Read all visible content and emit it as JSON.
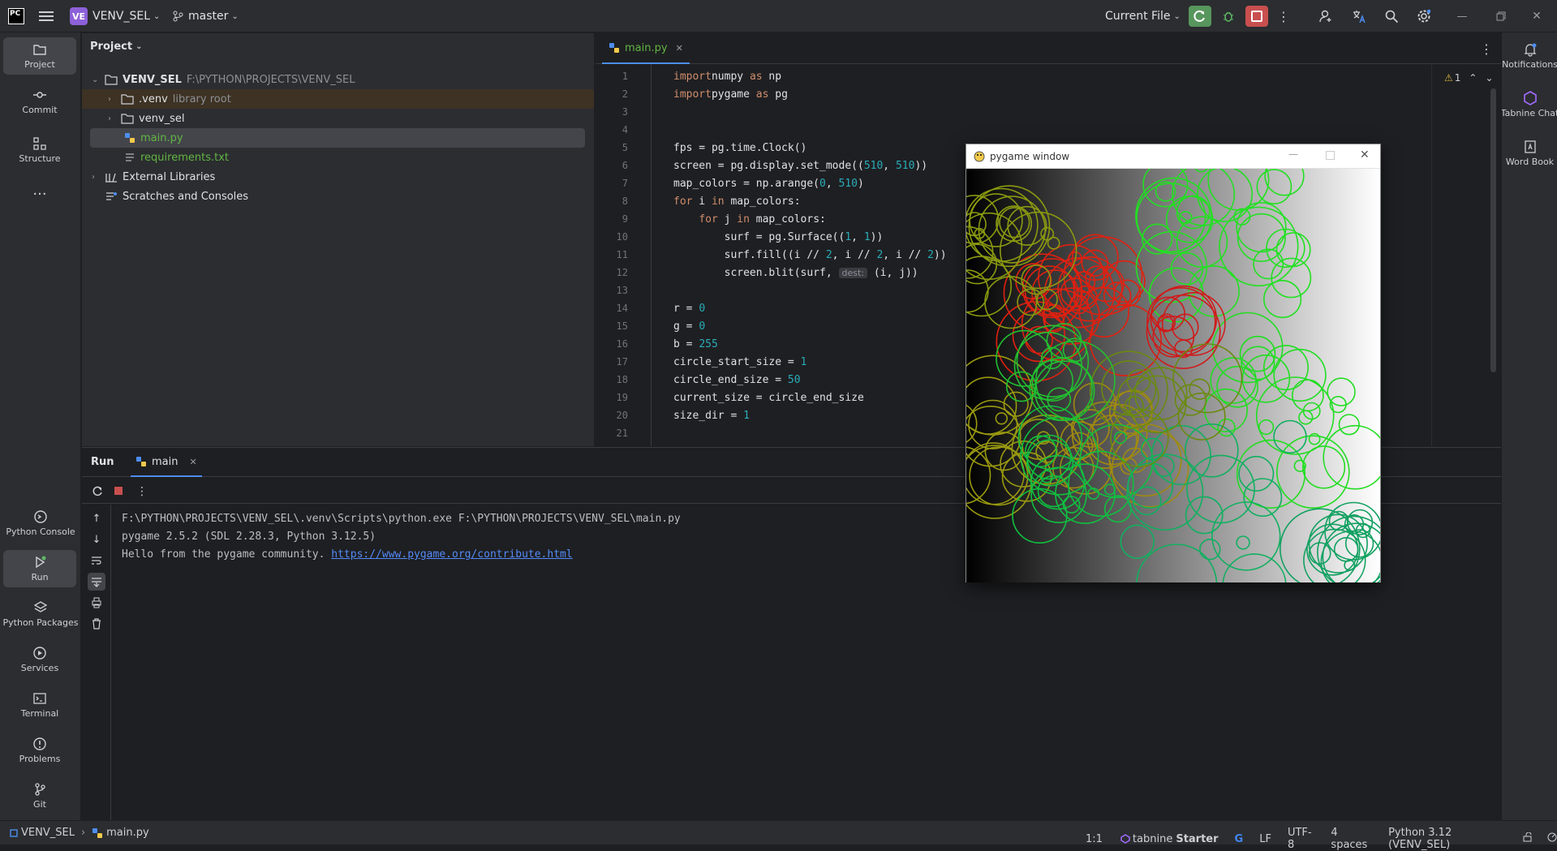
{
  "topbar": {
    "project_badge": "VE",
    "project_name": "VENV_SEL",
    "branch": "master",
    "run_config": "Current File"
  },
  "leftbar": {
    "items": [
      {
        "label": "Project",
        "icon": "folder-icon"
      },
      {
        "label": "Commit",
        "icon": "commit-icon"
      },
      {
        "label": "Structure",
        "icon": "structure-icon"
      },
      {
        "label": "Python Console",
        "icon": "python-console-icon"
      },
      {
        "label": "Run",
        "icon": "run-icon"
      },
      {
        "label": "Python Packages",
        "icon": "packages-icon"
      },
      {
        "label": "Services",
        "icon": "services-icon"
      },
      {
        "label": "Terminal",
        "icon": "terminal-icon"
      },
      {
        "label": "Problems",
        "icon": "problems-icon"
      },
      {
        "label": "Git",
        "icon": "git-icon"
      }
    ]
  },
  "rightbar": {
    "items": [
      {
        "label": "Notifications"
      },
      {
        "label": "Tabnine Chat"
      },
      {
        "label": "Word Book"
      }
    ]
  },
  "project": {
    "title": "Project",
    "tree": [
      {
        "name": "VENV_SEL",
        "hint": "F:\\PYTHON\\PROJECTS\\VENV_SEL"
      },
      {
        "name": ".venv",
        "hint": "library root"
      },
      {
        "name": "venv_sel",
        "hint": ""
      },
      {
        "name": "main.py",
        "hint": ""
      },
      {
        "name": "requirements.txt",
        "hint": ""
      },
      {
        "name": "External Libraries",
        "hint": ""
      },
      {
        "name": "Scratches and Consoles",
        "hint": ""
      }
    ]
  },
  "editor": {
    "tab": "main.py",
    "warnings": "1",
    "param_hint": "dest:",
    "lines": [
      {
        "n": "1",
        "tokens": [
          [
            "kw",
            "import"
          ],
          [
            "",
            "numpy "
          ],
          [
            "kw",
            "as"
          ],
          [
            "",
            " np"
          ]
        ]
      },
      {
        "n": "2",
        "tokens": [
          [
            "kw",
            "import"
          ],
          [
            "",
            "pygame "
          ],
          [
            "kw",
            "as"
          ],
          [
            "",
            " pg"
          ]
        ]
      },
      {
        "n": "3",
        "tokens": []
      },
      {
        "n": "4",
        "tokens": []
      },
      {
        "n": "5",
        "tokens": [
          [
            "",
            "fps = pg.time.Clock()"
          ]
        ]
      },
      {
        "n": "6",
        "tokens": [
          [
            "",
            "screen = pg.display.set_mode(("
          ],
          [
            "num",
            "510"
          ],
          [
            "",
            ", "
          ],
          [
            "num",
            "510"
          ],
          [
            "",
            "))"
          ]
        ]
      },
      {
        "n": "7",
        "tokens": [
          [
            "",
            "map_colors = np.arange("
          ],
          [
            "num",
            "0"
          ],
          [
            "",
            ", "
          ],
          [
            "num",
            "510"
          ],
          [
            "",
            ")"
          ]
        ]
      },
      {
        "n": "8",
        "tokens": [
          [
            "kw",
            "for"
          ],
          [
            "",
            " i "
          ],
          [
            "kw",
            "in"
          ],
          [
            "",
            " map_colors:"
          ]
        ]
      },
      {
        "n": "9",
        "tokens": [
          [
            "",
            "    "
          ],
          [
            "kw",
            "for"
          ],
          [
            "",
            " j "
          ],
          [
            "kw",
            "in"
          ],
          [
            "",
            " map_colors:"
          ]
        ]
      },
      {
        "n": "10",
        "tokens": [
          [
            "",
            "        surf = pg.Surface(("
          ],
          [
            "num",
            "1"
          ],
          [
            "",
            ", "
          ],
          [
            "num",
            "1"
          ],
          [
            "",
            "))"
          ]
        ]
      },
      {
        "n": "11",
        "tokens": [
          [
            "",
            "        surf.fill((i // "
          ],
          [
            "num",
            "2"
          ],
          [
            "",
            ", i // "
          ],
          [
            "num",
            "2"
          ],
          [
            "",
            ", i // "
          ],
          [
            "num",
            "2"
          ],
          [
            "",
            "))"
          ]
        ]
      },
      {
        "n": "12",
        "tokens": [
          [
            "",
            "        screen.blit(surf, "
          ],
          [
            "hint",
            "dest:"
          ],
          [
            "",
            " (i, j))"
          ]
        ]
      },
      {
        "n": "13",
        "tokens": []
      },
      {
        "n": "14",
        "tokens": [
          [
            "",
            "r = "
          ],
          [
            "num",
            "0"
          ]
        ]
      },
      {
        "n": "15",
        "tokens": [
          [
            "",
            "g = "
          ],
          [
            "num",
            "0"
          ]
        ]
      },
      {
        "n": "16",
        "tokens": [
          [
            "",
            "b = "
          ],
          [
            "num",
            "255"
          ]
        ]
      },
      {
        "n": "17",
        "tokens": [
          [
            "",
            "circle_start_size = "
          ],
          [
            "num",
            "1"
          ]
        ]
      },
      {
        "n": "18",
        "tokens": [
          [
            "",
            "circle_end_size = "
          ],
          [
            "num",
            "50"
          ]
        ]
      },
      {
        "n": "19",
        "tokens": [
          [
            "",
            "current_size = circle_end_size"
          ]
        ]
      },
      {
        "n": "20",
        "tokens": [
          [
            "",
            "size_dir = "
          ],
          [
            "num",
            "1"
          ]
        ]
      },
      {
        "n": "21",
        "tokens": []
      }
    ]
  },
  "run": {
    "title": "Run",
    "tab": "main",
    "output": [
      "F:\\PYTHON\\PROJECTS\\VENV_SEL\\.venv\\Scripts\\python.exe F:\\PYTHON\\PROJECTS\\VENV_SEL\\main.py",
      "pygame 2.5.2 (SDL 2.28.3, Python 3.12.5)",
      "Hello from the pygame community. "
    ],
    "link": "https://www.pygame.org/contribute.html"
  },
  "pygame_window": {
    "title": "pygame window"
  },
  "statusbar": {
    "crumb_project": "VENV_SEL",
    "crumb_file": "main.py",
    "position": "1:1",
    "tabnine": "tabnine",
    "tabnine_plan": "Starter",
    "line_sep": "LF",
    "encoding": "UTF-8",
    "indent": "4 spaces",
    "interpreter": "Python 3.12 (VENV_SEL)"
  }
}
